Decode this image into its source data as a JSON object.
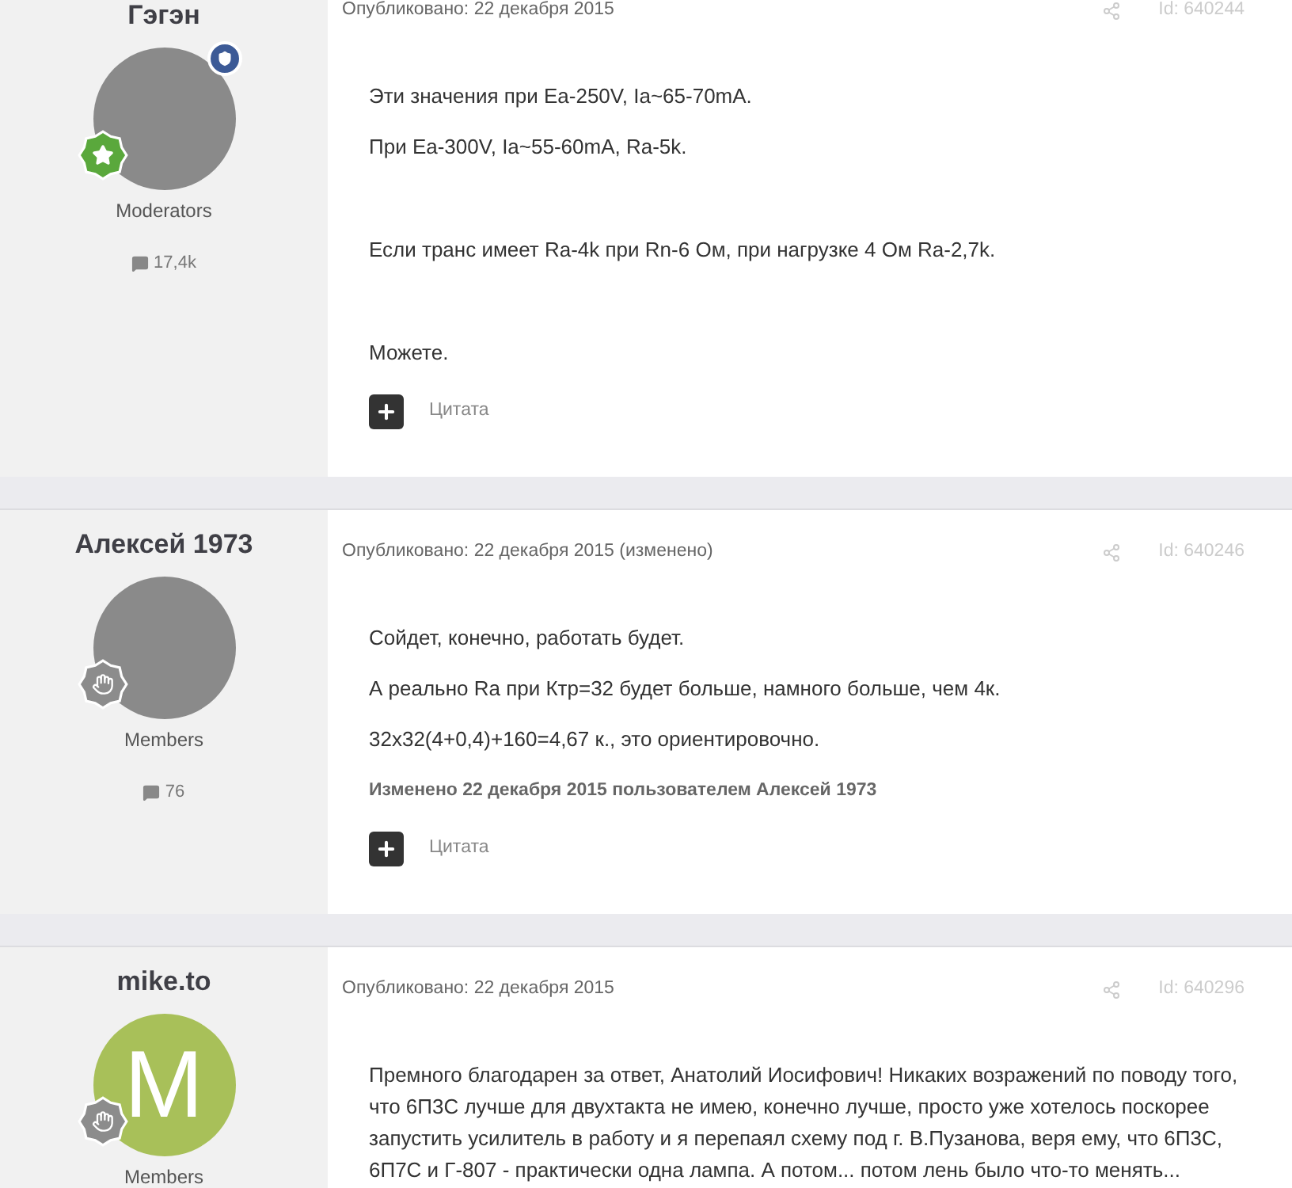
{
  "posts": [
    {
      "author": "Гэгэн",
      "avatar": {
        "kind": "photo"
      },
      "moderator_shield": true,
      "badge": {
        "kind": "star"
      },
      "group": "Moderators",
      "post_count": "17,4k",
      "date": "Опубликовано: 22 декабря 2015",
      "id": "Id: 640244",
      "paragraph_groups": [
        [
          "Эти значения при Ea-250V, Ia~65-70mA.",
          "При Ea-300V, Ia~55-60mA, Ra-5k."
        ],
        [
          "Если транс имеет Ra-4k при Rn-6 Ом, при нагрузке 4 Ом Ra-2,7k."
        ],
        [
          "Можете."
        ]
      ],
      "quote_label": "Цитата"
    },
    {
      "author": "Алексей 1973",
      "avatar": {
        "kind": "photo"
      },
      "badge": {
        "kind": "hand"
      },
      "group": "Members",
      "post_count": "76",
      "date": "Опубликовано: 22 декабря 2015 (изменено)",
      "id": "Id: 640246",
      "paragraph_groups": [
        [
          "Сойдет, конечно, работать будет.",
          "А реально Ra при Ктр=32 будет больше, намного больше, чем 4к.",
          "32х32(4+0,4)+160=4,67 к., это ориентировочно."
        ]
      ],
      "edit_note": "Изменено 22 декабря 2015 пользователем Алексей 1973",
      "quote_label": "Цитата"
    },
    {
      "author": "mike.to",
      "avatar": {
        "kind": "letter",
        "letter": "M",
        "color": "#a8c059"
      },
      "badge": {
        "kind": "hand"
      },
      "group": "Members",
      "date": "Опубликовано: 22 декабря 2015",
      "id": "Id: 640296",
      "paragraph_groups": [
        [
          "Премного благодарен за ответ, Анатолий Иосифович! Никаких возражений по поводу того, что 6П3С лучше для двухтакта не имею, конечно лучше, просто уже хотелось поскорее запустить усилитель в работу и я перепаял схему под г. В.Пузанова, веря ему, что 6П3С, 6П7С и Г-807 - практически одна лампа. А потом... потом лень было что-то менять..."
        ]
      ]
    }
  ]
}
